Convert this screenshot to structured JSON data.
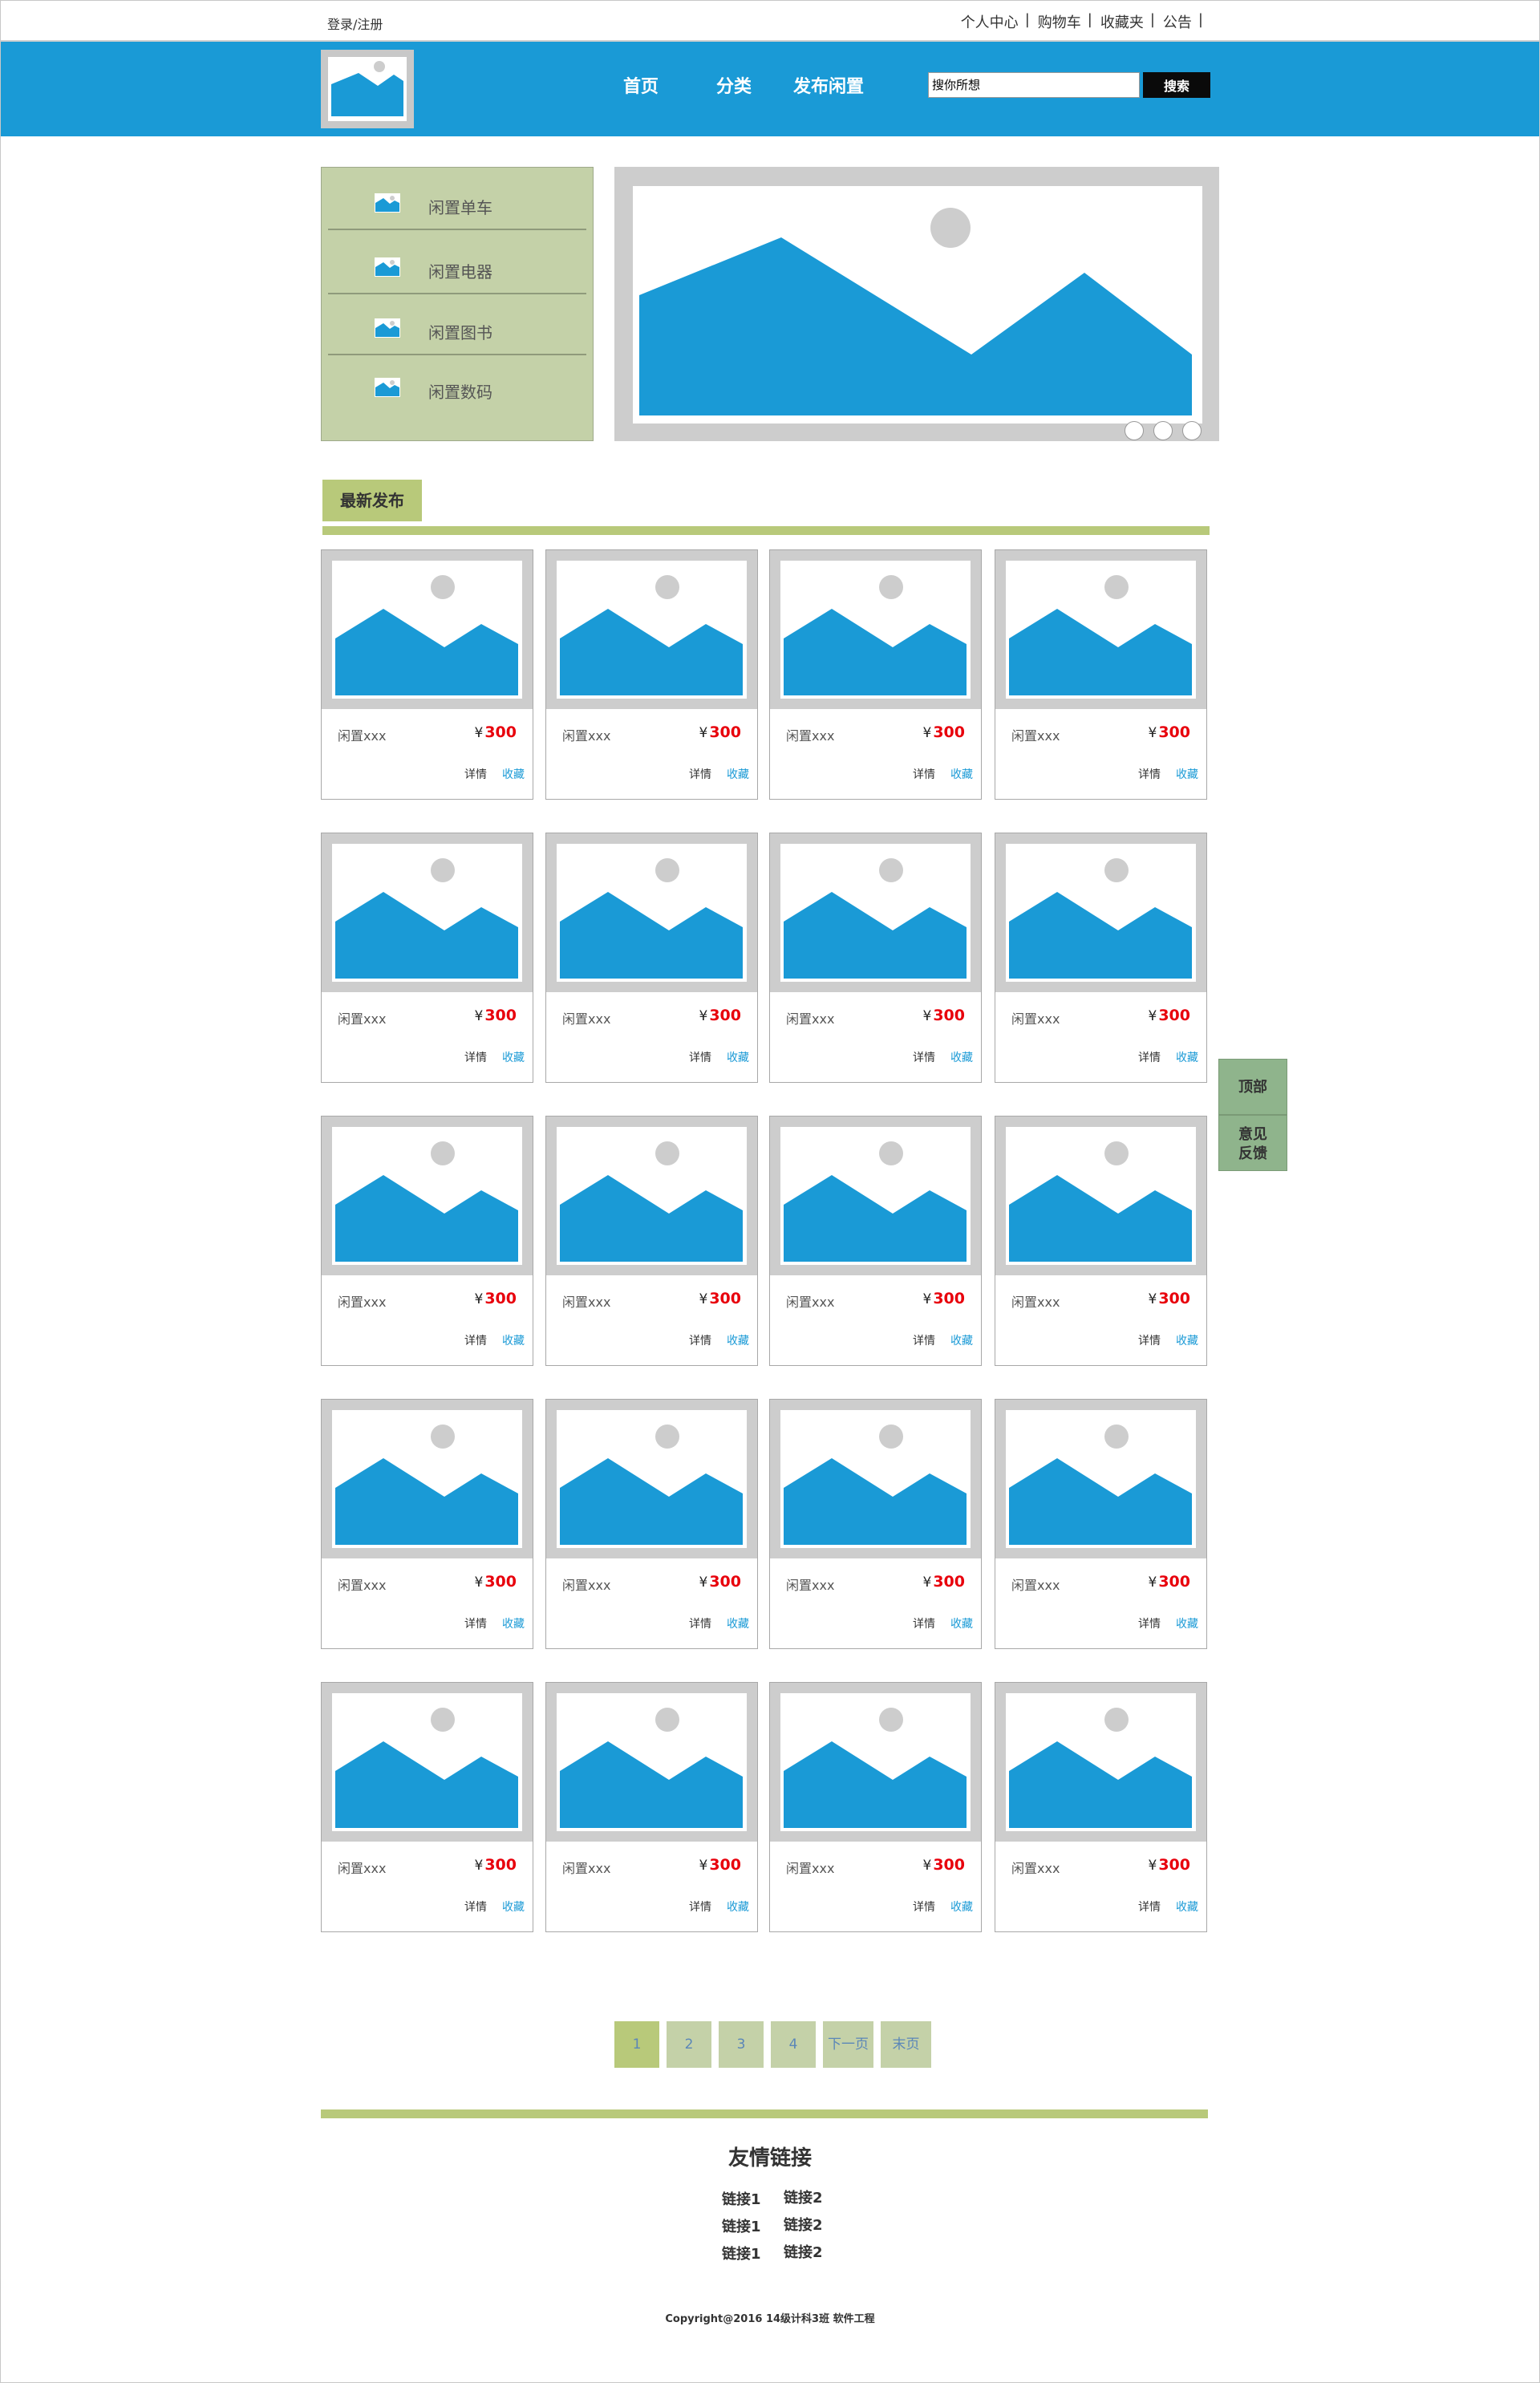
{
  "topbar": {
    "login": "登录/注册",
    "links": [
      "个人中心",
      "购物车",
      "收藏夹",
      "公告"
    ]
  },
  "header": {
    "nav": [
      "首页",
      "分类",
      "发布闲置"
    ],
    "search_placeholder": "搜你所想",
    "search_button": "搜索"
  },
  "categories": [
    "闲置单车",
    "闲置电器",
    "闲置图书",
    "闲置数码"
  ],
  "section_title": "最新发布",
  "product": {
    "name": "闲置xxx",
    "currency": "¥",
    "price": "300",
    "detail": "详情",
    "favorite": "收藏"
  },
  "side_buttons": {
    "top": "顶部",
    "feedback_line1": "意见",
    "feedback_line2": "反馈"
  },
  "pagination": [
    "1",
    "2",
    "3",
    "4",
    "下一页",
    "末页"
  ],
  "pagination_active": "1",
  "footer": {
    "friend_links_title": "友情链接",
    "links_col1": [
      "链接1",
      "链接1",
      "链接1"
    ],
    "links_col2": [
      "链接2",
      "链接2",
      "链接2"
    ],
    "copyright": "Copyright@2016 14级计科3班 软件工程"
  },
  "colors": {
    "header_blue": "#1a9ad6",
    "green_accent": "#b8c97a",
    "menu_green": "#c4d1a8",
    "price_red": "#e8000c",
    "side_button_green": "#8fb48c"
  }
}
